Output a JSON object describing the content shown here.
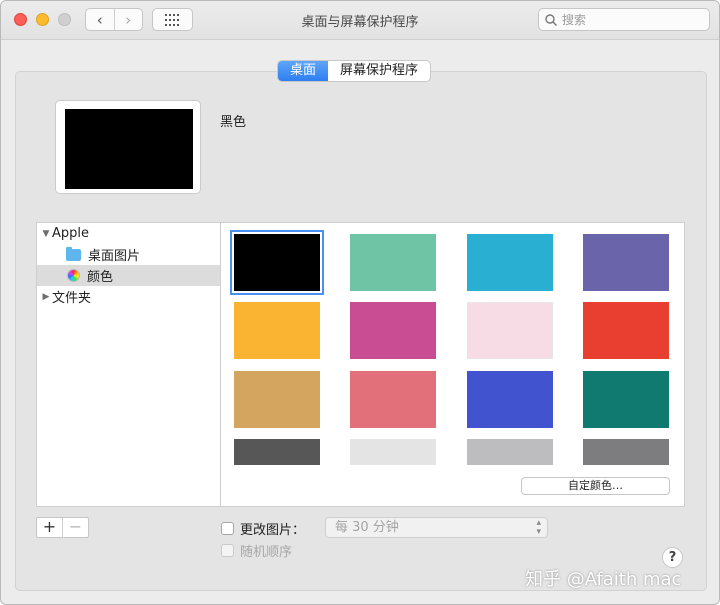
{
  "window": {
    "title": "桌面与屏幕保护程序"
  },
  "toolbar": {
    "back": "‹",
    "forward": "›",
    "search_placeholder": "搜索"
  },
  "tabs": [
    {
      "label": "桌面",
      "active": true
    },
    {
      "label": "屏幕保护程序",
      "active": false
    }
  ],
  "preview": {
    "color_name": "黑色",
    "color": "#000000"
  },
  "sidebar": {
    "apple": "Apple",
    "desktop_pictures": "桌面图片",
    "colors": "颜色",
    "folders": "文件夹"
  },
  "swatches": [
    "#000000",
    "#6fc4a6",
    "#29afd1",
    "#6a65ab",
    "#fbb432",
    "#c94d92",
    "#f8dce5",
    "#e83f31",
    "#d4a55e",
    "#e2707a",
    "#4253cf",
    "#117a70",
    "#575757",
    "#e4e4e4",
    "#bdbdc0",
    "#7d7d80"
  ],
  "selected_swatch": 0,
  "custom_color_button": "自定颜色…",
  "bottom": {
    "add": "+",
    "remove": "−",
    "change_picture": "更改图片：",
    "interval": "每 30 分钟",
    "random_order": "随机顺序",
    "help": "?"
  },
  "watermark": "知乎 @Afaith mac"
}
